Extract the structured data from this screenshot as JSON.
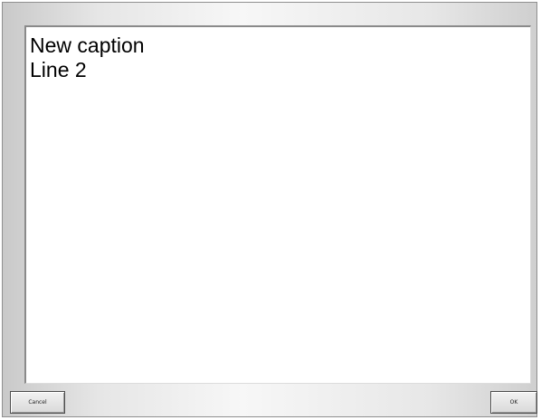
{
  "editor": {
    "lines": [
      "New caption",
      "Line 2"
    ]
  },
  "buttons": {
    "cancel_label": "Cancel",
    "ok_label": "OK"
  }
}
